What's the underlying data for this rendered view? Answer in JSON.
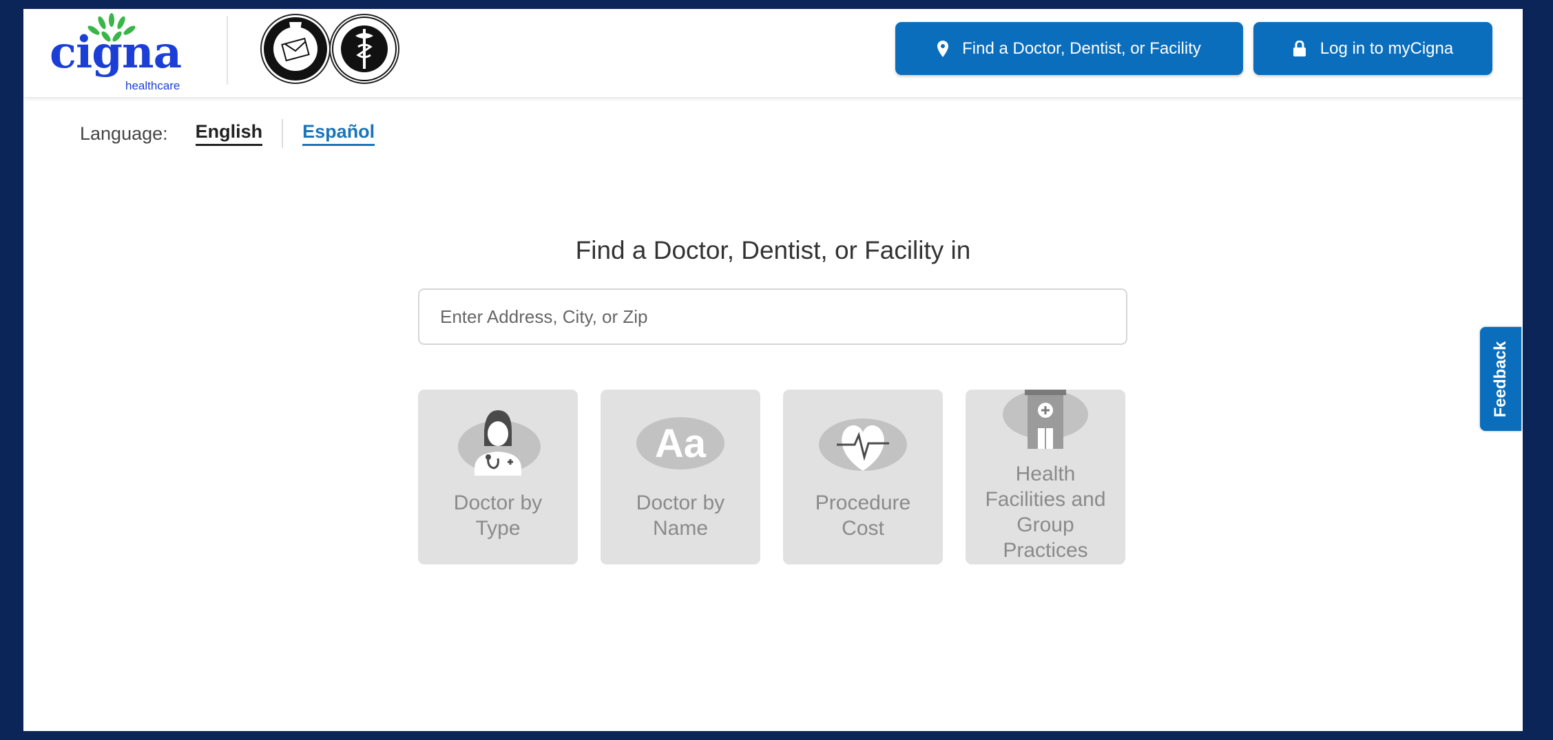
{
  "header": {
    "logo": {
      "wordmark": "cigna",
      "sub": "healthcare"
    },
    "find_button": {
      "label": "Find a Doctor, Dentist, or Facility",
      "icon": "map-pin-icon"
    },
    "login_button": {
      "label": "Log in to myCigna",
      "icon": "lock-icon"
    }
  },
  "language": {
    "label": "Language:",
    "options": [
      "English",
      "Español"
    ],
    "selected": "English"
  },
  "main": {
    "title": "Find a Doctor, Dentist, or Facility in",
    "search": {
      "placeholder": "Enter Address, City, or Zip",
      "value": ""
    },
    "tiles": [
      {
        "label": "Doctor by\nType",
        "icon": "doctor-icon"
      },
      {
        "label": "Doctor by\nName",
        "icon": "text-aa-icon"
      },
      {
        "label": "Procedure\nCost",
        "icon": "heartbeat-icon"
      },
      {
        "label": "Health\nFacilities and\nGroup\nPractices",
        "icon": "hospital-building-icon"
      }
    ]
  },
  "feedback": {
    "label": "Feedback"
  },
  "colors": {
    "primary": "#0a6ebd",
    "brand": "#1b3fd6",
    "leaf": "#39b54a",
    "tile_bg": "#e1e1e1",
    "frame": "#0b2559"
  }
}
